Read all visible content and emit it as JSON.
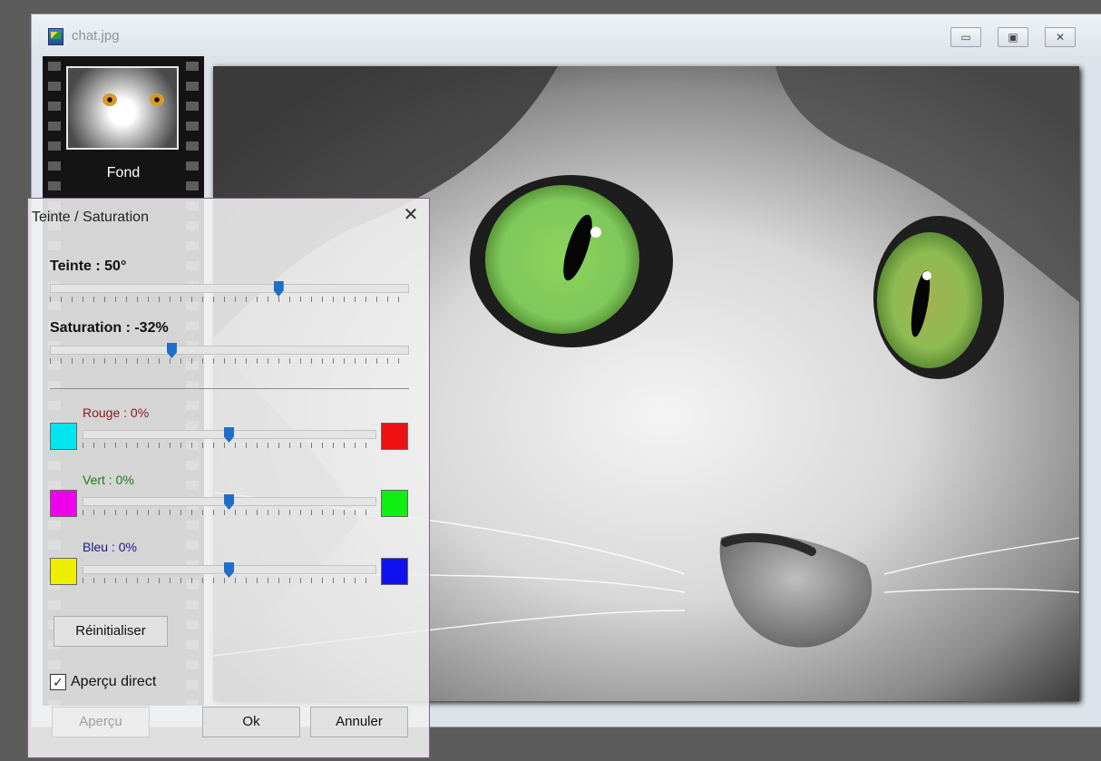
{
  "window": {
    "title": "chat.jpg",
    "controls": {
      "minimize": "▭",
      "maximize": "▣",
      "close": "✕"
    }
  },
  "layers": [
    {
      "label": "Fond",
      "thumbnail_icon": "cat-photo-thumbnail"
    }
  ],
  "canvas": {
    "image_icon": "cat-photo-gray-green-eyes"
  },
  "dialog": {
    "title": "Teinte / Saturation",
    "close_glyph": "✕",
    "hue": {
      "label": "Teinte : 50°",
      "value": 50,
      "min": -180,
      "max": 180
    },
    "saturation": {
      "label": "Saturation : -32%",
      "value": -32,
      "min": -100,
      "max": 100
    },
    "channels": [
      {
        "label": "Rouge : 0%",
        "value": 0,
        "min": -100,
        "max": 100,
        "label_color": "#8b1a1a",
        "left_color": "#00e5ee",
        "right_color": "#ee1111"
      },
      {
        "label": "Vert : 0%",
        "value": 0,
        "min": -100,
        "max": 100,
        "label_color": "#1e7a1e",
        "left_color": "#ee00ee",
        "right_color": "#11ee11"
      },
      {
        "label": "Bleu : 0%",
        "value": 0,
        "min": -100,
        "max": 100,
        "label_color": "#1a1a8b",
        "left_color": "#eeee00",
        "right_color": "#1111ee"
      }
    ],
    "reset_label": "Réinitialiser",
    "live_preview": {
      "label": "Aperçu direct",
      "checked": true,
      "check_glyph": "✓"
    },
    "buttons": {
      "preview": "Aperçu",
      "ok": "Ok",
      "cancel": "Annuler"
    }
  }
}
